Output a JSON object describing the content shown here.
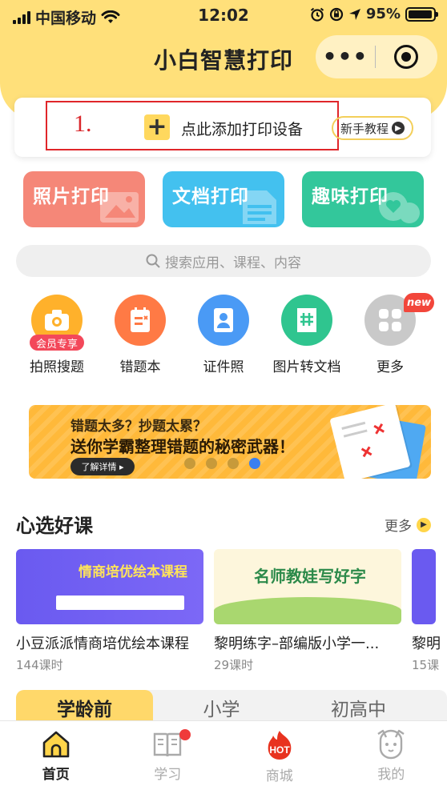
{
  "status_bar": {
    "carrier": "中国移动",
    "time": "12:02",
    "battery": "95%",
    "battery_level": 0.95
  },
  "header": {
    "title": "小白智慧打印",
    "more_label": "•••"
  },
  "device_card": {
    "step_label": "1.",
    "add_label": "点此添加打印设备",
    "tutorial_label": "新手教程"
  },
  "print_tiles": [
    {
      "label": "照片打印",
      "color": "#f58778"
    },
    {
      "label": "文档打印",
      "color": "#43c1ef"
    },
    {
      "label": "趣味打印",
      "color": "#33c79b"
    }
  ],
  "search": {
    "placeholder": "搜索应用、课程、内容"
  },
  "features": [
    {
      "label": "拍照搜题",
      "tag": "会员专享",
      "icon": "camera-icon",
      "color": "#ffb12b"
    },
    {
      "label": "错题本",
      "icon": "notebook-icon",
      "color": "#ff7a45"
    },
    {
      "label": "证件照",
      "icon": "id-photo-icon",
      "color": "#4a9af5"
    },
    {
      "label": "图片转文档",
      "icon": "document-hash-icon",
      "color": "#2fc58f"
    },
    {
      "label": "更多",
      "icon": "grid-icon",
      "color": "#c9c9c9",
      "badge": "new"
    }
  ],
  "banner": {
    "subtitle": "错题太多？抄题太累？",
    "headline": "送你学霸整理错题的秘密武器！",
    "button": "了解详情 ▸",
    "page_count": 4,
    "active_page": 4
  },
  "courses_section": {
    "title": "心选好课",
    "more_label": "更多",
    "items": [
      {
        "title": "小豆派派情商培优绘本课程",
        "count": "144课时",
        "thumb_text": "情商培优绘本课程"
      },
      {
        "title": "黎明练字–部编版小学一...",
        "count": "29课时",
        "thumb_text": "名师教娃写好字"
      },
      {
        "title": "黎明",
        "count": "15课"
      }
    ]
  },
  "grade_tabs": [
    {
      "label": "学龄前",
      "active": true
    },
    {
      "label": "小学",
      "active": false
    },
    {
      "label": "初高中",
      "active": false
    }
  ],
  "bottom_nav": [
    {
      "label": "首页",
      "icon": "home-icon",
      "active": true
    },
    {
      "label": "学习",
      "icon": "book-icon",
      "active": false
    },
    {
      "label": "商城",
      "icon": "hot-icon",
      "active": false
    },
    {
      "label": "我的",
      "icon": "profile-icon",
      "active": false
    }
  ]
}
